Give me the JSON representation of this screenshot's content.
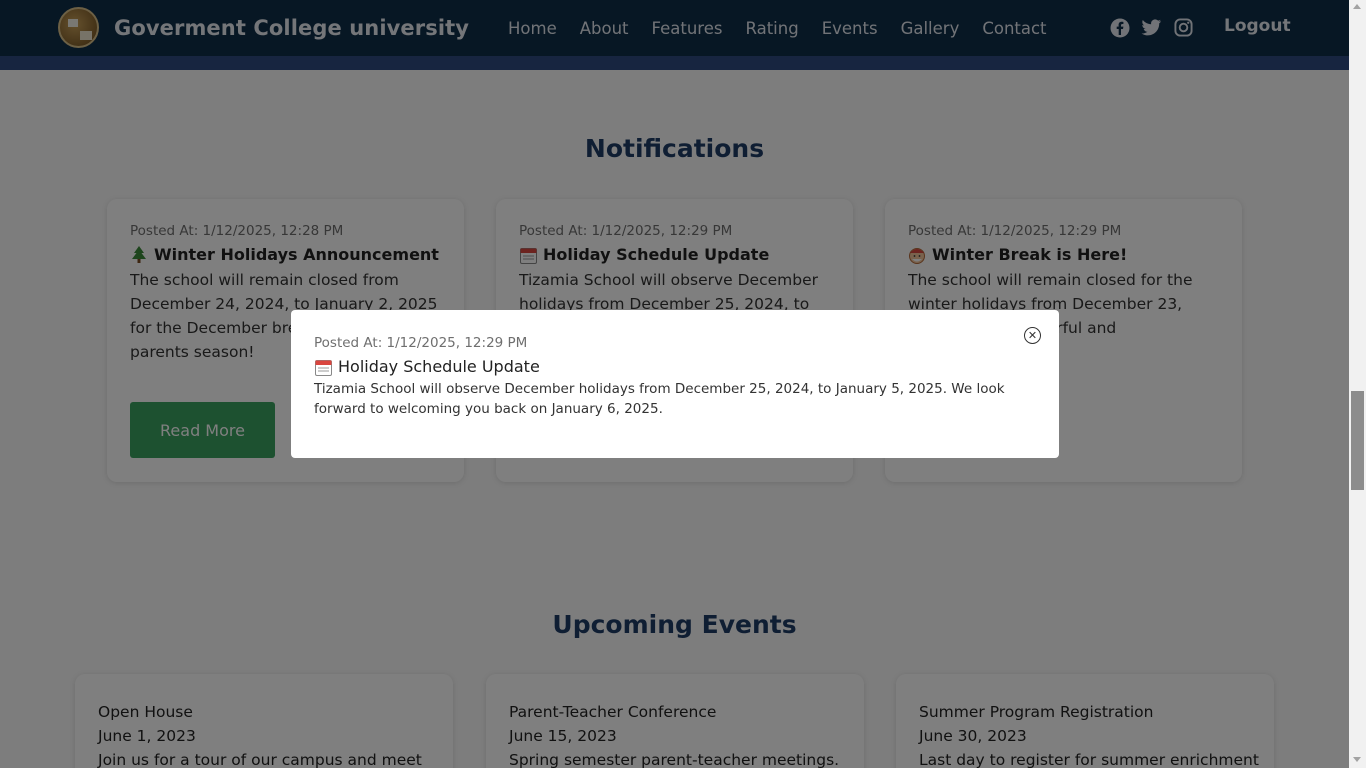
{
  "navbar": {
    "brand": "Goverment College university",
    "links": [
      "Home",
      "About",
      "Features",
      "Rating",
      "Events",
      "Gallery",
      "Contact"
    ],
    "social_icons": [
      "facebook-icon",
      "twitter-icon",
      "instagram-icon"
    ],
    "logout": "Logout"
  },
  "notifications": {
    "title": "Notifications",
    "cards": [
      {
        "posted": "Posted At: 1/12/2025, 12:28 PM",
        "icon": "christmas-tree-icon",
        "title": "Winter Holidays Announcement",
        "body": "The school will remain closed from December 24, 2024, to January 2, 2025 for the December bre students and parents season!",
        "button": "Read More"
      },
      {
        "posted": "Posted At: 1/12/2025, 12:29 PM",
        "icon": "calendar-icon",
        "title": "Holiday Schedule Update",
        "body": "Tizamia School will observe December holidays from December 25, 2024, to"
      },
      {
        "posted": "Posted At: 1/12/2025, 12:29 PM",
        "icon": "santa-icon",
        "title": "Winter Break is Here!",
        "body": "The school will remain closed for the winter holidays from December 23, 2024, ave a wonderful and"
      }
    ]
  },
  "events": {
    "title": "Upcoming Events",
    "cards": [
      {
        "title": "Open House",
        "date": "June 1, 2023",
        "desc": "Join us for a tour of our campus and meet"
      },
      {
        "title": "Parent-Teacher Conference",
        "date": "June 15, 2023",
        "desc": "Spring semester parent-teacher meetings."
      },
      {
        "title": "Summer Program Registration",
        "date": "June 30, 2023",
        "desc": "Last day to register for summer enrichment"
      }
    ]
  },
  "modal": {
    "posted": "Posted At: 1/12/2025, 12:29 PM",
    "icon": "calendar-icon",
    "title": "Holiday Schedule Update",
    "body": "Tizamia School will observe December holidays from December 25, 2024, to January 5, 2025. We look forward to welcoming you back on January 6, 2025.",
    "close_icon": "close-circle-icon"
  },
  "colors": {
    "navbar": "#0f2e48",
    "accent_stripe": "#2f4a80",
    "heading": "#1f3d66",
    "button": "#3aa360"
  }
}
